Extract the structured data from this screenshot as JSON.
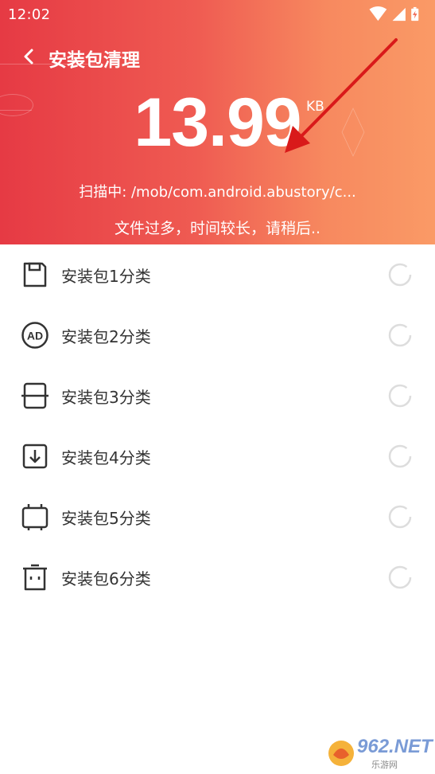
{
  "status_bar": {
    "time": "12:02",
    "icons": [
      "wifi-icon",
      "signal-icon",
      "battery-charging-icon"
    ]
  },
  "header": {
    "title": "安装包清理",
    "back_icon": "chevron-left-icon",
    "size_value": "13.99",
    "size_unit": "KB",
    "scan_text": "扫描中: /mob/com.android.abustory/c...",
    "hint_text": "文件过多，时间较长，请稍后..",
    "gradient_colors": [
      "#e63a44",
      "#fa9a66"
    ]
  },
  "categories": [
    {
      "label": "安装包1分类",
      "icon": "sd-card-icon"
    },
    {
      "label": "安装包2分类",
      "icon": "ad-icon"
    },
    {
      "label": "安装包3分类",
      "icon": "frame-icon"
    },
    {
      "label": "安装包4分类",
      "icon": "download-icon"
    },
    {
      "label": "安装包5分类",
      "icon": "chip-icon"
    },
    {
      "label": "安装包6分类",
      "icon": "trash-icon"
    }
  ],
  "watermark": {
    "text": "962.NET",
    "sub": "乐游网"
  },
  "colors": {
    "text": "#333333",
    "spinner": "#dddddd",
    "arrow": "#d91a1a"
  }
}
